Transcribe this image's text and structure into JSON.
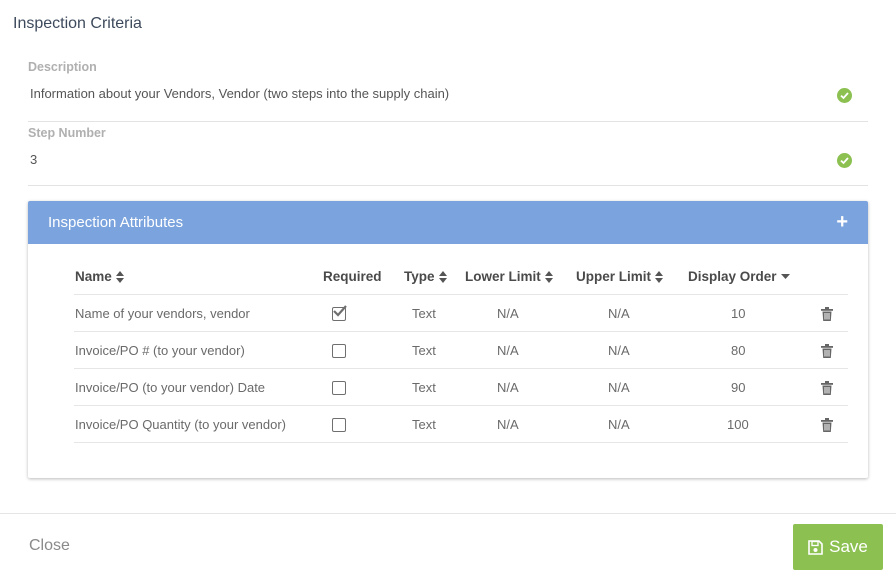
{
  "title": "Inspection Criteria",
  "fields": {
    "description": {
      "label": "Description",
      "value": "Information about your Vendors, Vendor (two steps into the supply chain)"
    },
    "step_number": {
      "label": "Step Number",
      "value": "3"
    }
  },
  "attributes_panel": {
    "title": "Inspection Attributes",
    "add_label": "+",
    "columns": {
      "name": "Name",
      "required": "Required",
      "type": "Type",
      "lower": "Lower Limit",
      "upper": "Upper Limit",
      "order": "Display Order"
    },
    "rows": [
      {
        "name": "Name of your vendors, vendor",
        "required": true,
        "type": "Text",
        "lower": "N/A",
        "upper": "N/A",
        "order": "10"
      },
      {
        "name": "Invoice/PO # (to your vendor)",
        "required": false,
        "type": "Text",
        "lower": "N/A",
        "upper": "N/A",
        "order": "80"
      },
      {
        "name": "Invoice/PO (to your vendor) Date",
        "required": false,
        "type": "Text",
        "lower": "N/A",
        "upper": "N/A",
        "order": "90"
      },
      {
        "name": "Invoice/PO Quantity (to your vendor)",
        "required": false,
        "type": "Text",
        "lower": "N/A",
        "upper": "N/A",
        "order": "100"
      }
    ]
  },
  "footer": {
    "close_label": "Close",
    "save_label": "Save"
  },
  "colors": {
    "accent_green": "#8cc152",
    "panel_header": "#7ba3dd"
  }
}
